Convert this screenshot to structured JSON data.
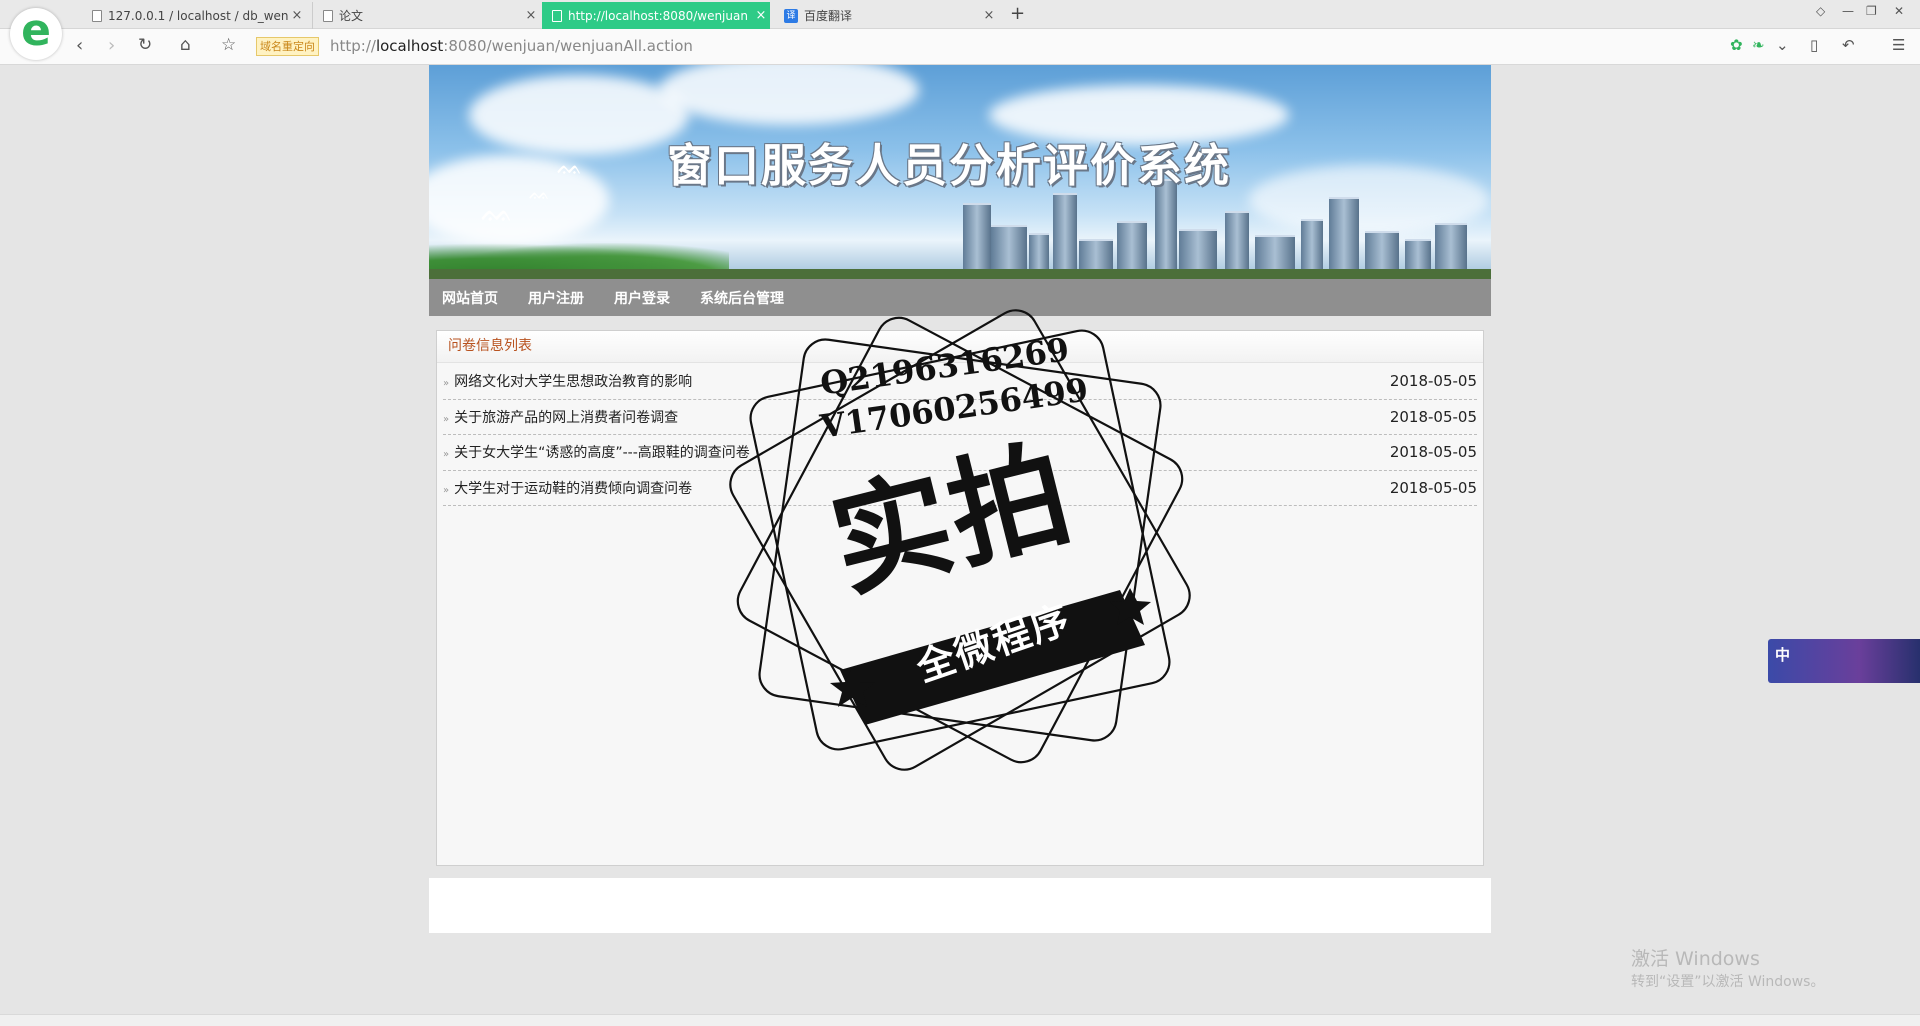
{
  "browser": {
    "tabs": [
      {
        "title": "127.0.0.1 / localhost / db_wenjuan",
        "active": false
      },
      {
        "title": "论文",
        "active": false
      },
      {
        "title": "http://localhost:8080/wenjuan",
        "active": true
      },
      {
        "title": "百度翻译",
        "active": false
      }
    ],
    "redirect_badge": "域名重定向",
    "url_prefix": "http://",
    "url_host": "localhost",
    "url_rest": ":8080/wenjuan/wenjuanAll.action",
    "tab_close_glyph": "×",
    "new_tab_glyph": "+",
    "accent_color": "#2ecb87"
  },
  "banner": {
    "title": "窗口服务人员分析评价系统"
  },
  "nav": {
    "items": [
      "网站首页",
      "用户注册",
      "用户登录",
      "系统后台管理"
    ]
  },
  "section": {
    "title": "问卷信息列表",
    "title_color": "#b8521f"
  },
  "surveys": [
    {
      "title": "网络文化对大学生思想政治教育的影响",
      "date": "2018-05-05"
    },
    {
      "title": "关于旅游产品的网上消费者问卷调查",
      "date": "2018-05-05"
    },
    {
      "title": "关于女大学生“诱惑的高度”---高跟鞋的调查问卷",
      "date": "2018-05-05"
    },
    {
      "title": "大学生对于运动鞋的消费倾向调查问卷",
      "date": "2018-05-05"
    }
  ],
  "watermark": {
    "line1": "Q2196316269",
    "line2": "V17060256499",
    "big": "实拍",
    "band": "全微程序"
  },
  "ime": {
    "label": "中"
  },
  "os": {
    "activate_title": "激活 Windows",
    "activate_sub": "转到“设置”以激活 Windows。"
  }
}
